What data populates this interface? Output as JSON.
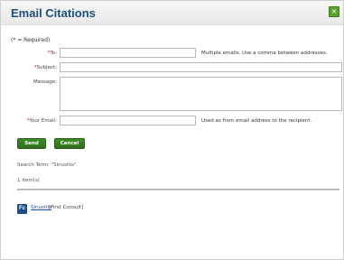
{
  "dialog": {
    "title": "Email Citations",
    "close_symbol": "×"
  },
  "form": {
    "required_note": "(* = Required)",
    "to_label": "To:",
    "to_value": "",
    "to_hint": "Multiple emails. Use a comma between addresses.",
    "subject_label": "Subject:",
    "subject_value": "",
    "message_label": "Message:",
    "message_value": "",
    "your_email_label": "Your Email:",
    "your_email_value": "",
    "your_email_hint": "Used as from email address to the recipient.",
    "required_star": "*"
  },
  "buttons": {
    "send": "Send",
    "cancel": "Cancel"
  },
  "results": {
    "search_term": "Search Term: \"Sinusitis\"",
    "count": "1 item(s)",
    "items": [
      {
        "badge": "Fc",
        "title": "Sinusitis",
        "source": "[First Consult]"
      }
    ]
  },
  "colors": {
    "title": "#1f4f7a",
    "button": "#2e6c1d",
    "required": "#d00000",
    "link": "#1a4ea8"
  }
}
